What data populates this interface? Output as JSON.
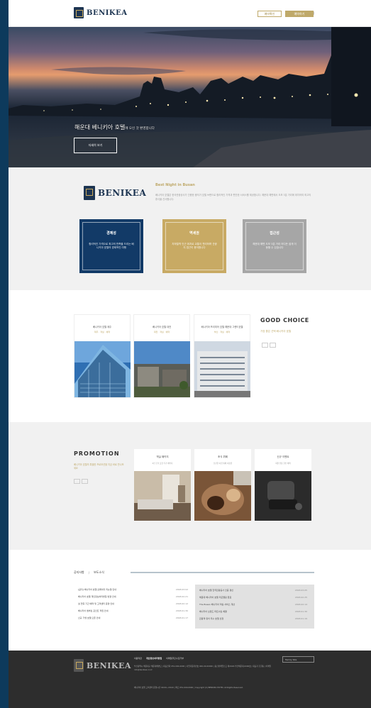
{
  "brand": {
    "name": "BENIKEA"
  },
  "header": {
    "nav": [
      "로그인",
      "회원가입"
    ],
    "outline_button": "예약확인",
    "filled_button": "예약하기"
  },
  "hero": {
    "title": "해운대 베니키아 호텔",
    "title_suffix": "에 오신 것 환영합니다",
    "button": "자세히 보기"
  },
  "about": {
    "title": "Best Night in Busan",
    "desc": "베니키아 호텔은 한국관광공사가 인증한 중저가 호텔 브랜드로 합리적인 가격과 편안한 서비스를 제공합니다. 해운대 해변에서 도보 3분 거리에 위치하여 최고의 휴식을 선사합니다.",
    "cards": [
      {
        "title": "경제성",
        "desc": "합리적인 가격으로 최고의 만족을 드리는 베니키아 호텔의 경제적인 여행"
      },
      {
        "title": "역세권",
        "desc": "지하철역 인근 위치로 교통이 편리하며 관광지 접근이 용이합니다"
      },
      {
        "title": "접근성",
        "desc": "해운대 해변 도보 3분 거리 어디든 쉽게 이동할 수 있습니다"
      }
    ]
  },
  "rooms": {
    "items": [
      {
        "title": "베니키아 호텔 제주",
        "sub": "제주 · 객실 · 예약"
      },
      {
        "title": "베니키아 호텔 대전",
        "sub": "대전 · 객실 · 예약"
      },
      {
        "title": "베니키아 프리미어 호텔 해운대 그랜드호텔",
        "sub": "부산 · 객실 · 예약"
      }
    ],
    "heading": "GOOD CHOICE",
    "subheading": "가장 좋은 선택 베니키아 호텔"
  },
  "promotion": {
    "heading": "PROMOTION",
    "desc": "베니키아 호텔의 특별한 프로모션을 지금 바로 만나보세요",
    "items": [
      {
        "title": "객실 패키지",
        "desc": "2인 조식 포함 특가 패키지"
      },
      {
        "title": "조식 뷔페",
        "desc": "신선한 아침 뷔페 이용권"
      },
      {
        "title": "신규 이벤트",
        "desc": "회원 전용 할인 혜택"
      }
    ]
  },
  "notice": {
    "tabs": [
      "공지사항",
      "/",
      "보도소식"
    ],
    "left": [
      {
        "text": "[공지] 베니키아 호텔 홈페이지 리뉴얼 안내",
        "date": "2018.03.02"
      },
      {
        "text": "베니키아 호텔 개인정보처리방침 변경 안내",
        "date": "2018.02.21"
      },
      {
        "text": "설 연휴 기간 예약 및 고객센터 운영 안내",
        "date": "2018.02.12"
      },
      {
        "text": "베니키아 멤버십 포인트 적립 안내",
        "date": "2018.01.30"
      },
      {
        "text": "신규 가맹 호텔 오픈 안내",
        "date": "2018.01.17"
      }
    ],
    "right": [
      {
        "text": "베니키아 호텔 한국관광공사 인증 갱신",
        "date": "2018.03.05"
      },
      {
        "text": "해운대 베니키아 호텔 리모델링 완료",
        "date": "2018.02.25"
      },
      {
        "text": "The Busan 베니키아 객실 서비스 개선",
        "date": "2018.02.14"
      },
      {
        "text": "베니키아 브랜드 파트너십 체결",
        "date": "2018.01.30"
      },
      {
        "text": "관광객 유치 우수 호텔 선정",
        "date": "2018.01.19"
      }
    ]
  },
  "footer": {
    "links": [
      "이용약관",
      "개인정보처리방침",
      "이메일무단수집거부"
    ],
    "family": "Family Site",
    "info": "부산광역시 해운대구 해운대해변로 | 대표전화 051-000-0000 | 사업자등록번호 000-00-00000 | 통신판매업신고 제2018-부산해운대-0000호 | 대표자 홍길동 | 이메일 info@benikea.co.kr",
    "info2": "베니키아 호텔 고객센터 운영시간 09:00~18:00 | 팩스 051-000-0000 | Copyright (C) BENIKEA HOTEL All Rights Reserved."
  },
  "colors": {
    "navy": "#123a67",
    "gold": "#c8aa64",
    "gray": "#a6a6a6",
    "footer": "#2d2d2d"
  }
}
